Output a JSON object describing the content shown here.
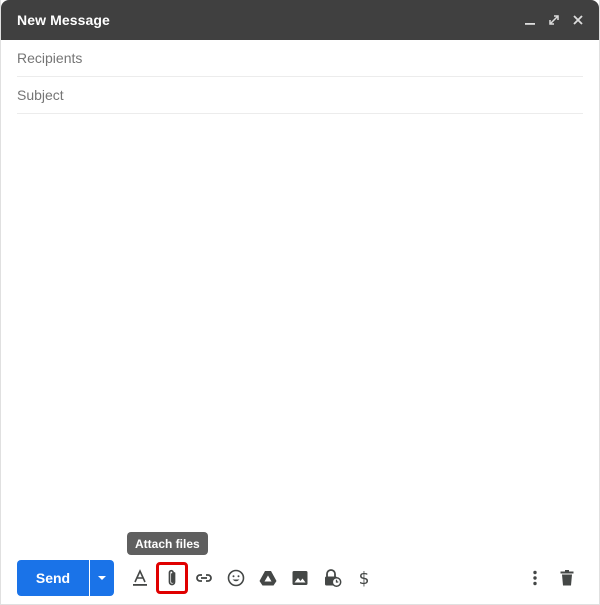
{
  "window": {
    "title": "New Message",
    "controls": [
      "minimize-icon",
      "expand-icon",
      "close-icon"
    ]
  },
  "recipients": {
    "placeholder": "Recipients",
    "value": ""
  },
  "subject": {
    "placeholder": "Subject",
    "value": ""
  },
  "message_body": "",
  "toolbar": {
    "send_label": "Send",
    "tools": [
      "text-format-icon",
      "attach-icon",
      "link-icon",
      "emoji-icon",
      "drive-icon",
      "image-icon",
      "confidential-mode-icon",
      "dollar-icon"
    ],
    "right_tools": [
      "more-options-icon",
      "trash-icon"
    ],
    "highlighted_tool": "attach-icon"
  },
  "tooltip": {
    "text": "Attach files"
  },
  "colors": {
    "titlebar": "#404040",
    "send_button": "#1a73e8",
    "tooltip": "#5f5f5f",
    "highlight_border": "#e00000",
    "icon": "#444746"
  }
}
